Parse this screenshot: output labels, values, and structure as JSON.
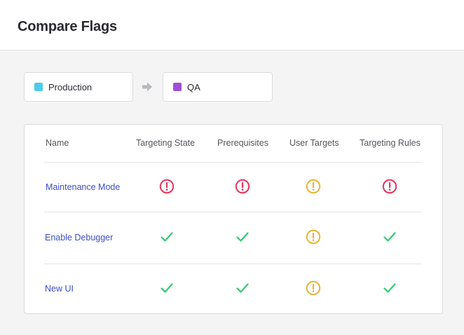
{
  "header": {
    "title": "Compare Flags"
  },
  "environments": {
    "source": {
      "name": "Production",
      "color": "#4ccbec"
    },
    "target": {
      "name": "QA",
      "color": "#a04fd6"
    }
  },
  "icons": {
    "arrow": "arrow-right-icon",
    "error": "alert-circle-icon",
    "warning": "alert-circle-icon",
    "ok": "check-icon"
  },
  "colors": {
    "error": "#e8325c",
    "warning": "#e8b436",
    "ok": "#2fcc71",
    "link": "#3a4fc8"
  },
  "table": {
    "columns": [
      "Name",
      "Targeting State",
      "Prerequisites",
      "User Targets",
      "Targeting Rules"
    ],
    "rows": [
      {
        "name": "Maintenance Mode",
        "statuses": [
          "error",
          "error",
          "warning",
          "error"
        ]
      },
      {
        "name": "Enable Debugger",
        "statuses": [
          "ok",
          "ok",
          "warning",
          "ok"
        ]
      },
      {
        "name": "New UI",
        "statuses": [
          "ok",
          "ok",
          "warning",
          "ok"
        ]
      }
    ]
  }
}
